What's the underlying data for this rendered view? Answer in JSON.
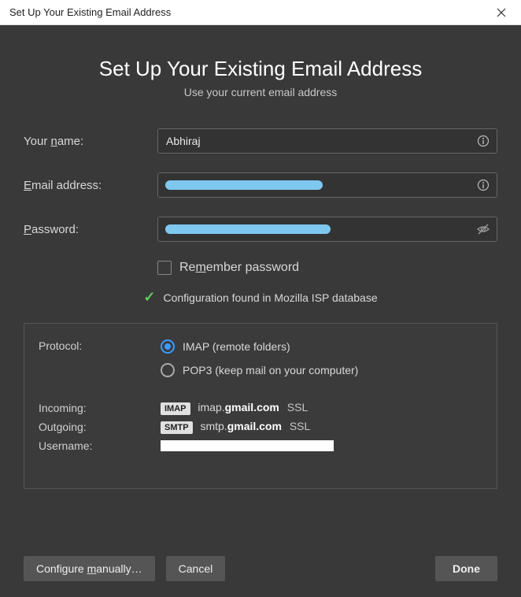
{
  "window": {
    "title": "Set Up Your Existing Email Address"
  },
  "header": {
    "title": "Set Up Your Existing Email Address",
    "subtitle": "Use your current email address"
  },
  "form": {
    "name_label_pre": "Your ",
    "name_label_u": "n",
    "name_label_post": "ame:",
    "name_value": "Abhiraj",
    "email_label_u": "E",
    "email_label_post": "mail address:",
    "email_value": "",
    "password_label_u": "P",
    "password_label_post": "assword:",
    "password_value": "",
    "remember_pre": "Re",
    "remember_u": "m",
    "remember_post": "ember password"
  },
  "status": {
    "text": "Configuration found in Mozilla ISP database"
  },
  "config": {
    "protocol_label": "Protocol:",
    "imap_label": "IMAP (remote folders)",
    "pop3_label": "POP3 (keep mail on your computer)",
    "incoming_label": "Incoming:",
    "outgoing_label": "Outgoing:",
    "username_label": "Username:",
    "imap_badge": "IMAP",
    "smtp_badge": "SMTP",
    "incoming_pre": "imap.",
    "incoming_bold": "gmail.com",
    "outgoing_pre": "smtp.",
    "outgoing_bold": "gmail.com",
    "ssl": "SSL"
  },
  "buttons": {
    "configure_pre": "Configure ",
    "configure_u": "m",
    "configure_post": "anually…",
    "cancel": "Cancel",
    "done": "Done"
  }
}
